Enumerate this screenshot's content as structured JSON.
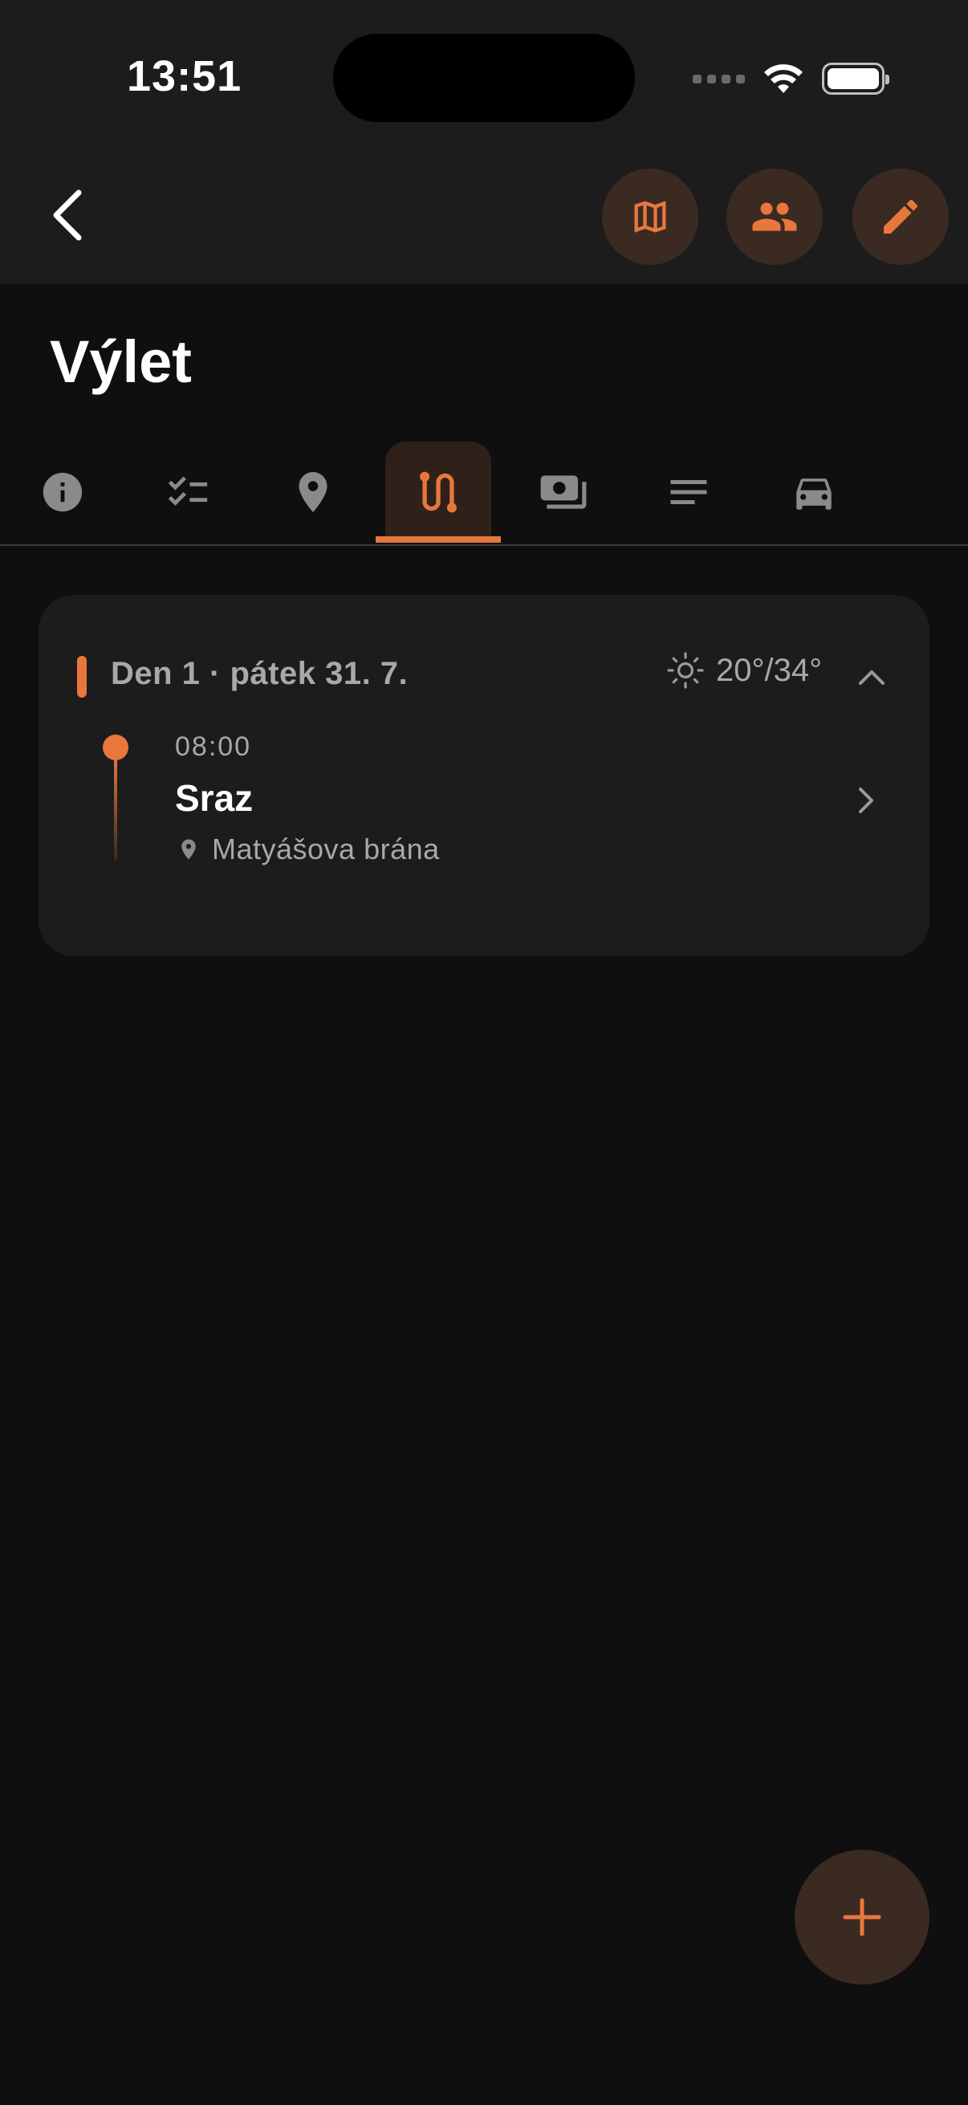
{
  "status_bar": {
    "time": "13:51"
  },
  "header": {
    "back_icon": "chevron-left-icon",
    "actions": [
      "map-icon",
      "group-icon",
      "edit-icon"
    ]
  },
  "page": {
    "title": "Výlet"
  },
  "tabs": [
    {
      "icon": "info-icon",
      "active": false
    },
    {
      "icon": "checklist-icon",
      "active": false
    },
    {
      "icon": "location-pin-icon",
      "active": false
    },
    {
      "icon": "route-icon",
      "active": true
    },
    {
      "icon": "money-icon",
      "active": false
    },
    {
      "icon": "notes-icon",
      "active": false
    },
    {
      "icon": "car-icon",
      "active": false
    }
  ],
  "day": {
    "title": "Den 1 · pátek 31. 7.",
    "weather_icon": "sun-icon",
    "temperature": "20°/34°",
    "events": [
      {
        "time": "08:00",
        "title": "Sraz",
        "location": "Matyášova brána"
      }
    ]
  },
  "fab": {
    "label": "+"
  },
  "colors": {
    "accent": "#e8773e",
    "background": "#0f0f0f",
    "surface": "#1c1c1c",
    "muted_text": "#a8a8a8"
  }
}
